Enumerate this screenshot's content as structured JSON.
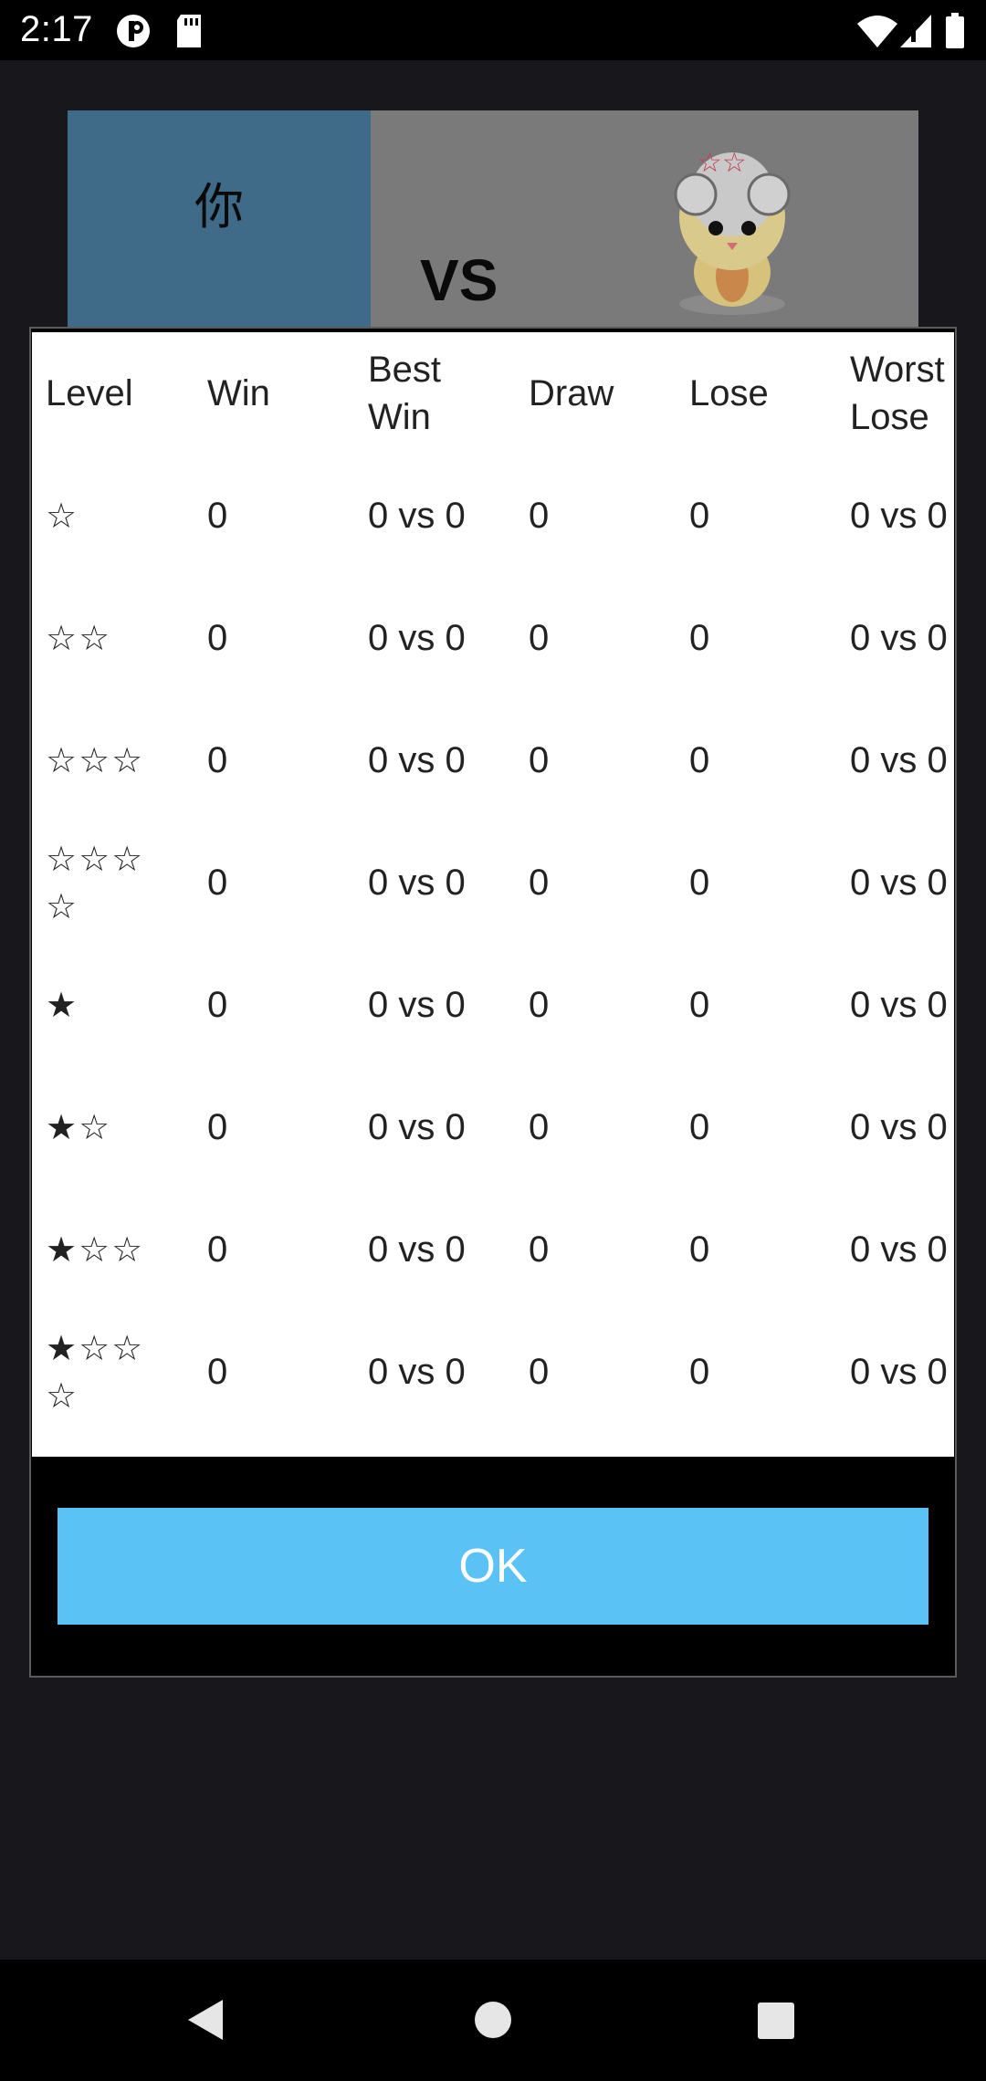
{
  "status_bar": {
    "time": "2:17"
  },
  "background": {
    "you_label": "你",
    "vs_label": "VS"
  },
  "dialog": {
    "headers": [
      "Level",
      "Win",
      "Best Win",
      "Draw",
      "Lose",
      "Worst Lose"
    ],
    "rows": [
      {
        "level": "☆",
        "win": "0",
        "best_win": "0 vs 0",
        "draw": "0",
        "lose": "0",
        "worst_lose": "0 vs 0"
      },
      {
        "level": "☆☆",
        "win": "0",
        "best_win": "0 vs 0",
        "draw": "0",
        "lose": "0",
        "worst_lose": "0 vs 0"
      },
      {
        "level": "☆☆☆",
        "win": "0",
        "best_win": "0 vs 0",
        "draw": "0",
        "lose": "0",
        "worst_lose": "0 vs 0"
      },
      {
        "level": "☆☆☆☆",
        "win": "0",
        "best_win": "0 vs 0",
        "draw": "0",
        "lose": "0",
        "worst_lose": "0 vs 0"
      },
      {
        "level": "★",
        "win": "0",
        "best_win": "0 vs 0",
        "draw": "0",
        "lose": "0",
        "worst_lose": "0 vs 0"
      },
      {
        "level": "★☆",
        "win": "0",
        "best_win": "0 vs 0",
        "draw": "0",
        "lose": "0",
        "worst_lose": "0 vs 0"
      },
      {
        "level": "★☆☆",
        "win": "0",
        "best_win": "0 vs 0",
        "draw": "0",
        "lose": "0",
        "worst_lose": "0 vs 0"
      },
      {
        "level": "★☆☆☆",
        "win": "0",
        "best_win": "0 vs 0",
        "draw": "0",
        "lose": "0",
        "worst_lose": "0 vs 0"
      }
    ],
    "ok_label": "OK"
  },
  "colors": {
    "ok_button": "#5bc2f6",
    "dialog_bg": "#000000",
    "table_bg": "#ffffff"
  },
  "icons": [
    "signal-app-icon",
    "sd-card-icon",
    "wifi-icon",
    "cell-signal-icon",
    "battery-icon",
    "back-icon",
    "home-icon",
    "recents-icon"
  ]
}
